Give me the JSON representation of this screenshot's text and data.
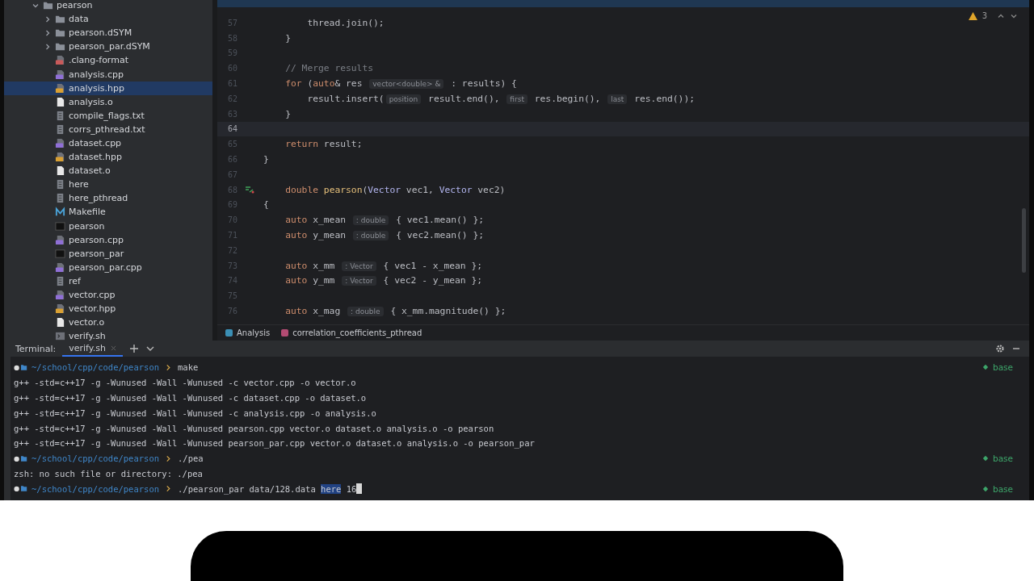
{
  "project_tree": [
    {
      "name": "pearson",
      "kind": "folder",
      "expanded": true,
      "selected": false,
      "children": [
        {
          "name": "data",
          "kind": "folder",
          "expanded": false,
          "selected": false
        },
        {
          "name": "pearson.dSYM",
          "kind": "folder",
          "expanded": false,
          "selected": false
        },
        {
          "name": "pearson_par.dSYM",
          "kind": "folder",
          "expanded": false,
          "selected": false
        },
        {
          "name": ".clang-format",
          "kind": "clang",
          "selected": false
        },
        {
          "name": "analysis.cpp",
          "kind": "cpp",
          "selected": false
        },
        {
          "name": "analysis.hpp",
          "kind": "hpp",
          "selected": true
        },
        {
          "name": "analysis.o",
          "kind": "obj",
          "selected": false
        },
        {
          "name": "compile_flags.txt",
          "kind": "txt",
          "selected": false
        },
        {
          "name": "corrs_pthread.txt",
          "kind": "txt",
          "selected": false
        },
        {
          "name": "dataset.cpp",
          "kind": "cpp",
          "selected": false
        },
        {
          "name": "dataset.hpp",
          "kind": "hpp",
          "selected": false
        },
        {
          "name": "dataset.o",
          "kind": "obj",
          "selected": false
        },
        {
          "name": "here",
          "kind": "txt",
          "selected": false
        },
        {
          "name": "here_pthread",
          "kind": "txt",
          "selected": false
        },
        {
          "name": "Makefile",
          "kind": "make",
          "selected": false
        },
        {
          "name": "pearson",
          "kind": "exe",
          "selected": false
        },
        {
          "name": "pearson.cpp",
          "kind": "cpp",
          "selected": false
        },
        {
          "name": "pearson_par",
          "kind": "exe",
          "selected": false
        },
        {
          "name": "pearson_par.cpp",
          "kind": "cpp",
          "selected": false
        },
        {
          "name": "ref",
          "kind": "txt",
          "selected": false
        },
        {
          "name": "vector.cpp",
          "kind": "cpp",
          "selected": false
        },
        {
          "name": "vector.hpp",
          "kind": "hpp",
          "selected": false
        },
        {
          "name": "vector.o",
          "kind": "obj",
          "selected": false
        },
        {
          "name": "verify.sh",
          "kind": "sh",
          "selected": false
        }
      ]
    }
  ],
  "editor": {
    "warnings": "3",
    "lines": [
      {
        "number": "57",
        "current": false,
        "segments": [
          {
            "kind": "plain",
            "text": "        thread.join();"
          }
        ]
      },
      {
        "number": "58",
        "current": false,
        "segments": [
          {
            "kind": "plain",
            "text": "    }"
          }
        ]
      },
      {
        "number": "59",
        "current": false
      },
      {
        "number": "60",
        "current": false,
        "segments": [
          {
            "kind": "comment",
            "text": "    // Merge results"
          }
        ]
      },
      {
        "number": "61",
        "current": false,
        "segments": [
          {
            "kind": "kw",
            "text": "    for "
          },
          {
            "kind": "plain",
            "text": "("
          },
          {
            "kind": "kw",
            "text": "auto"
          },
          {
            "kind": "plain",
            "text": "& res "
          },
          {
            "kind": "hint",
            "text": "vector<double> &"
          },
          {
            "kind": "plain",
            "text": " : results) {"
          }
        ]
      },
      {
        "number": "62",
        "current": false,
        "segments": [
          {
            "kind": "plain",
            "text": "        result.insert("
          },
          {
            "kind": "hint",
            "text": "position"
          },
          {
            "kind": "plain",
            "text": " result.end(), "
          },
          {
            "kind": "hint",
            "text": "first"
          },
          {
            "kind": "plain",
            "text": " res.begin(), "
          },
          {
            "kind": "hint",
            "text": "last"
          },
          {
            "kind": "plain",
            "text": " res.end());"
          }
        ]
      },
      {
        "number": "63",
        "current": false,
        "segments": [
          {
            "kind": "plain",
            "text": "    }"
          }
        ]
      },
      {
        "number": "64",
        "current": true
      },
      {
        "number": "65",
        "current": false,
        "segments": [
          {
            "kind": "kw",
            "text": "    return "
          },
          {
            "kind": "plain",
            "text": "result;"
          }
        ]
      },
      {
        "number": "66",
        "current": false,
        "segments": [
          {
            "kind": "plain",
            "text": "}"
          }
        ]
      },
      {
        "number": "67",
        "current": false
      },
      {
        "number": "68",
        "current": false,
        "override": true,
        "segments": [
          {
            "kind": "kw",
            "text": "    double "
          },
          {
            "kind": "fn",
            "text": "pearson"
          },
          {
            "kind": "plain",
            "text": "("
          },
          {
            "kind": "type",
            "text": "Vector"
          },
          {
            "kind": "plain",
            "text": " vec1, "
          },
          {
            "kind": "type",
            "text": "Vector"
          },
          {
            "kind": "plain",
            "text": " vec2)"
          }
        ]
      },
      {
        "number": "69",
        "current": false,
        "segments": [
          {
            "kind": "plain",
            "text": "{"
          }
        ]
      },
      {
        "number": "70",
        "current": false,
        "segments": [
          {
            "kind": "kw",
            "text": "    auto "
          },
          {
            "kind": "plain",
            "text": "x_mean "
          },
          {
            "kind": "hint",
            "text": ": double"
          },
          {
            "kind": "plain",
            "text": " { vec1.mean() };"
          }
        ]
      },
      {
        "number": "71",
        "current": false,
        "segments": [
          {
            "kind": "kw",
            "text": "    auto "
          },
          {
            "kind": "plain",
            "text": "y_mean "
          },
          {
            "kind": "hint",
            "text": ": double"
          },
          {
            "kind": "plain",
            "text": " { vec2.mean() };"
          }
        ]
      },
      {
        "number": "72",
        "current": false
      },
      {
        "number": "73",
        "current": false,
        "segments": [
          {
            "kind": "kw",
            "text": "    auto "
          },
          {
            "kind": "plain",
            "text": "x_mm "
          },
          {
            "kind": "hint",
            "text": ": Vector"
          },
          {
            "kind": "plain",
            "text": " { vec1 - x_mean };"
          }
        ]
      },
      {
        "number": "74",
        "current": false,
        "segments": [
          {
            "kind": "kw",
            "text": "    auto "
          },
          {
            "kind": "plain",
            "text": "y_mm "
          },
          {
            "kind": "hint",
            "text": ": Vector"
          },
          {
            "kind": "plain",
            "text": " { vec2 - y_mean };"
          }
        ]
      },
      {
        "number": "75",
        "current": false
      },
      {
        "number": "76",
        "current": false,
        "segments": [
          {
            "kind": "kw",
            "text": "    auto "
          },
          {
            "kind": "plain",
            "text": "x_mag "
          },
          {
            "kind": "hint",
            "text": ": double"
          },
          {
            "kind": "plain",
            "text": " { x_mm.magnitude() };"
          }
        ]
      }
    ],
    "breadcrumbs": [
      {
        "kind": "class",
        "text": "Analysis"
      },
      {
        "kind": "function",
        "text": "correlation_coefficients_pthread"
      }
    ]
  },
  "terminal": {
    "label": "Terminal:",
    "tabs": [
      {
        "label": "verify.sh",
        "selected": true
      }
    ],
    "lines": [
      {
        "kind": "prompt",
        "path": "~/school/cpp/code/pearson",
        "command": [
          {
            "text": "make",
            "highlighted": false
          }
        ],
        "env": "base",
        "cursor": false
      },
      {
        "kind": "output",
        "text": "g++ -std=c++17 -g -Wunused -Wall -Wunused -c vector.cpp -o vector.o"
      },
      {
        "kind": "output",
        "text": "g++ -std=c++17 -g -Wunused -Wall -Wunused -c dataset.cpp -o dataset.o"
      },
      {
        "kind": "output",
        "text": "g++ -std=c++17 -g -Wunused -Wall -Wunused -c analysis.cpp -o analysis.o"
      },
      {
        "kind": "output",
        "text": "g++ -std=c++17 -g -Wunused -Wall -Wunused pearson.cpp vector.o dataset.o analysis.o -o pearson"
      },
      {
        "kind": "output",
        "text": "g++ -std=c++17 -g -Wunused -Wall -Wunused pearson_par.cpp vector.o dataset.o analysis.o -o pearson_par"
      },
      {
        "kind": "prompt",
        "path": "~/school/cpp/code/pearson",
        "command": [
          {
            "text": "./pea",
            "highlighted": false
          }
        ],
        "env": "base",
        "cursor": false
      },
      {
        "kind": "output",
        "text": "zsh: no such file or directory: ./pea"
      },
      {
        "kind": "prompt",
        "path": "~/school/cpp/code/pearson",
        "command": [
          {
            "text": "./pearson_par data/128.data ",
            "highlighted": false
          },
          {
            "text": "here",
            "highlighted": true
          },
          {
            "text": " 16",
            "highlighted": false
          }
        ],
        "env": "base",
        "cursor": true
      }
    ]
  }
}
